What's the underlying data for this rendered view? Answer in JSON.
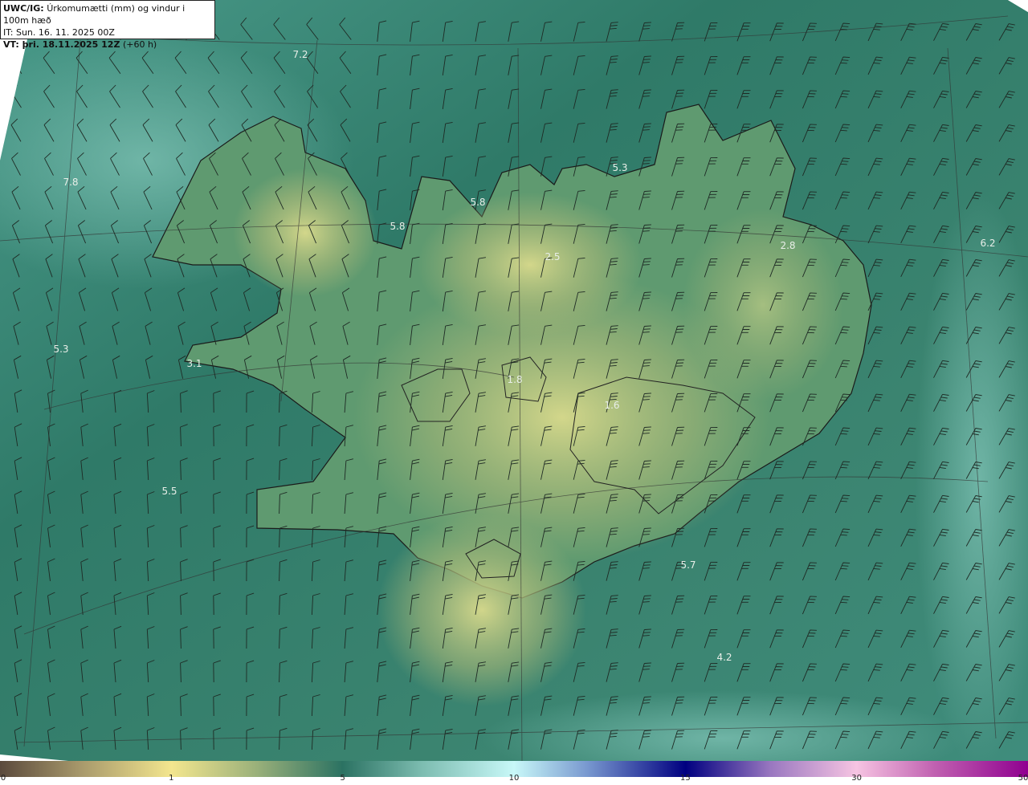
{
  "header": {
    "title_bold": "UWC/IG:",
    "title_rest": "Úrkomumætti (mm) og vindur i 100m hæð",
    "init_time": "IT: Sun. 16. 11. 2025 00Z",
    "valid_bold": "VT: þri. 18.11.2025 12Z",
    "valid_rest": "(+60 h)"
  },
  "map_labels": [
    "7.2",
    "7.8",
    "5.3",
    "3.1",
    "5.5",
    "5.8",
    "5.8",
    "5.3",
    "2.5",
    "2.8",
    "6.2",
    "1.8",
    "1.6",
    "5.7",
    "4.2"
  ],
  "colorbar": {
    "ticks": [
      "0",
      "1",
      "5",
      "10",
      "15",
      "30",
      "50"
    ],
    "colors": [
      "#5b4a3c",
      "#f3e68e",
      "#2b7262",
      "#c8f8f8",
      "#000080",
      "#f6c4e2",
      "#900090"
    ]
  },
  "colors": {
    "sea": "#2f7a68",
    "land_high": "#d8d888",
    "coast": "#1a1a1a"
  }
}
